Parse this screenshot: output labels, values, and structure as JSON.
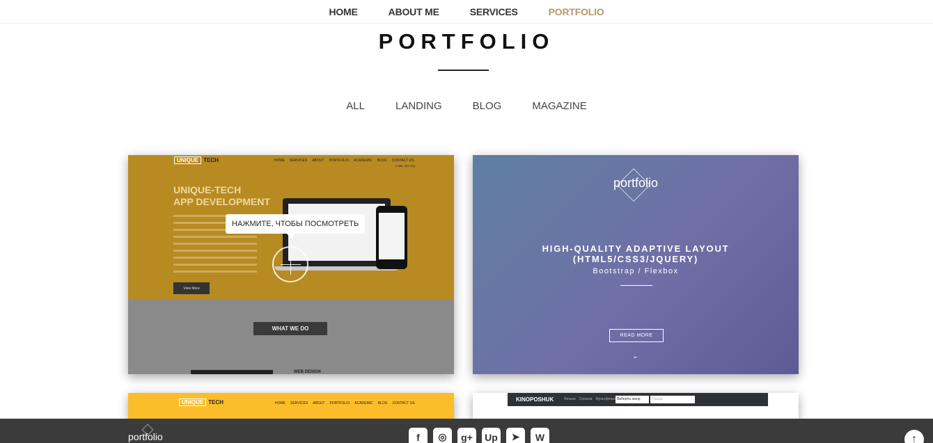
{
  "nav": {
    "items": [
      {
        "label": "HOME"
      },
      {
        "label": "ABOUT ME"
      },
      {
        "label": "SERVICES"
      },
      {
        "label": "PORTFOLIO"
      }
    ],
    "active_color": "#b49a6a"
  },
  "section": {
    "title": "PORTFOLIO",
    "filters": [
      {
        "label": "ALL"
      },
      {
        "label": "LANDING"
      },
      {
        "label": "BLOG"
      },
      {
        "label": "MAGAZINE"
      }
    ]
  },
  "cards": {
    "unique_tech": {
      "logo_box": "UNIQUE",
      "logo_text": "TECH",
      "menu": [
        "HOME",
        "SERVICES",
        "ABOUT",
        "PORTFOLIO",
        "ACADEMIC",
        "BLOG",
        "CONTACT US"
      ],
      "phone": "(+966- 322 222)",
      "heading_line1": "UNIQUE-TECH",
      "heading_line2": "APP DEVELOPMENT",
      "view_more": "View More",
      "tooltip": "НАЖМИТЕ, ЧТОБЫ ПОСМОТРЕТЬ",
      "what_we_do": "WHAT WE DO",
      "web_design": "WEB DESIGN"
    },
    "portfolio": {
      "logo": "portfolio",
      "heading_line1": "HIGH-QUALITY ADAPTIVE LAYOUT",
      "heading_line2": "(HTML5/CSS3/JQUERY)",
      "subtitle": "Bootstrap / Flexbox",
      "button": "READ MORE"
    },
    "unique_tech_2": {
      "logo_box": "UNIQUE",
      "logo_text": "TECH",
      "menu": [
        "HOME",
        "SERVICES",
        "ABOUT",
        "PORTFOLIO",
        "ACADEMIC",
        "BLOG",
        "CONTACT US"
      ]
    },
    "kinoposhuk": {
      "brand": "KINOPOSHUK",
      "links": [
        "Фільми",
        "Серіали",
        "Мультфільми"
      ],
      "select": "Виберіть жанр",
      "search_placeholder": "Пошук"
    }
  },
  "footer": {
    "logo": "portfolio",
    "social": [
      {
        "icon": "facebook-icon",
        "glyph": "f"
      },
      {
        "icon": "instagram-icon",
        "glyph": "◎"
      },
      {
        "icon": "google-plus-icon",
        "glyph": "g+"
      },
      {
        "icon": "upwork-icon",
        "glyph": "Up"
      },
      {
        "icon": "telegram-icon",
        "glyph": "➤"
      },
      {
        "icon": "vk-icon",
        "glyph": "W"
      }
    ],
    "scroll_top_icon": "arrow-up-icon"
  }
}
